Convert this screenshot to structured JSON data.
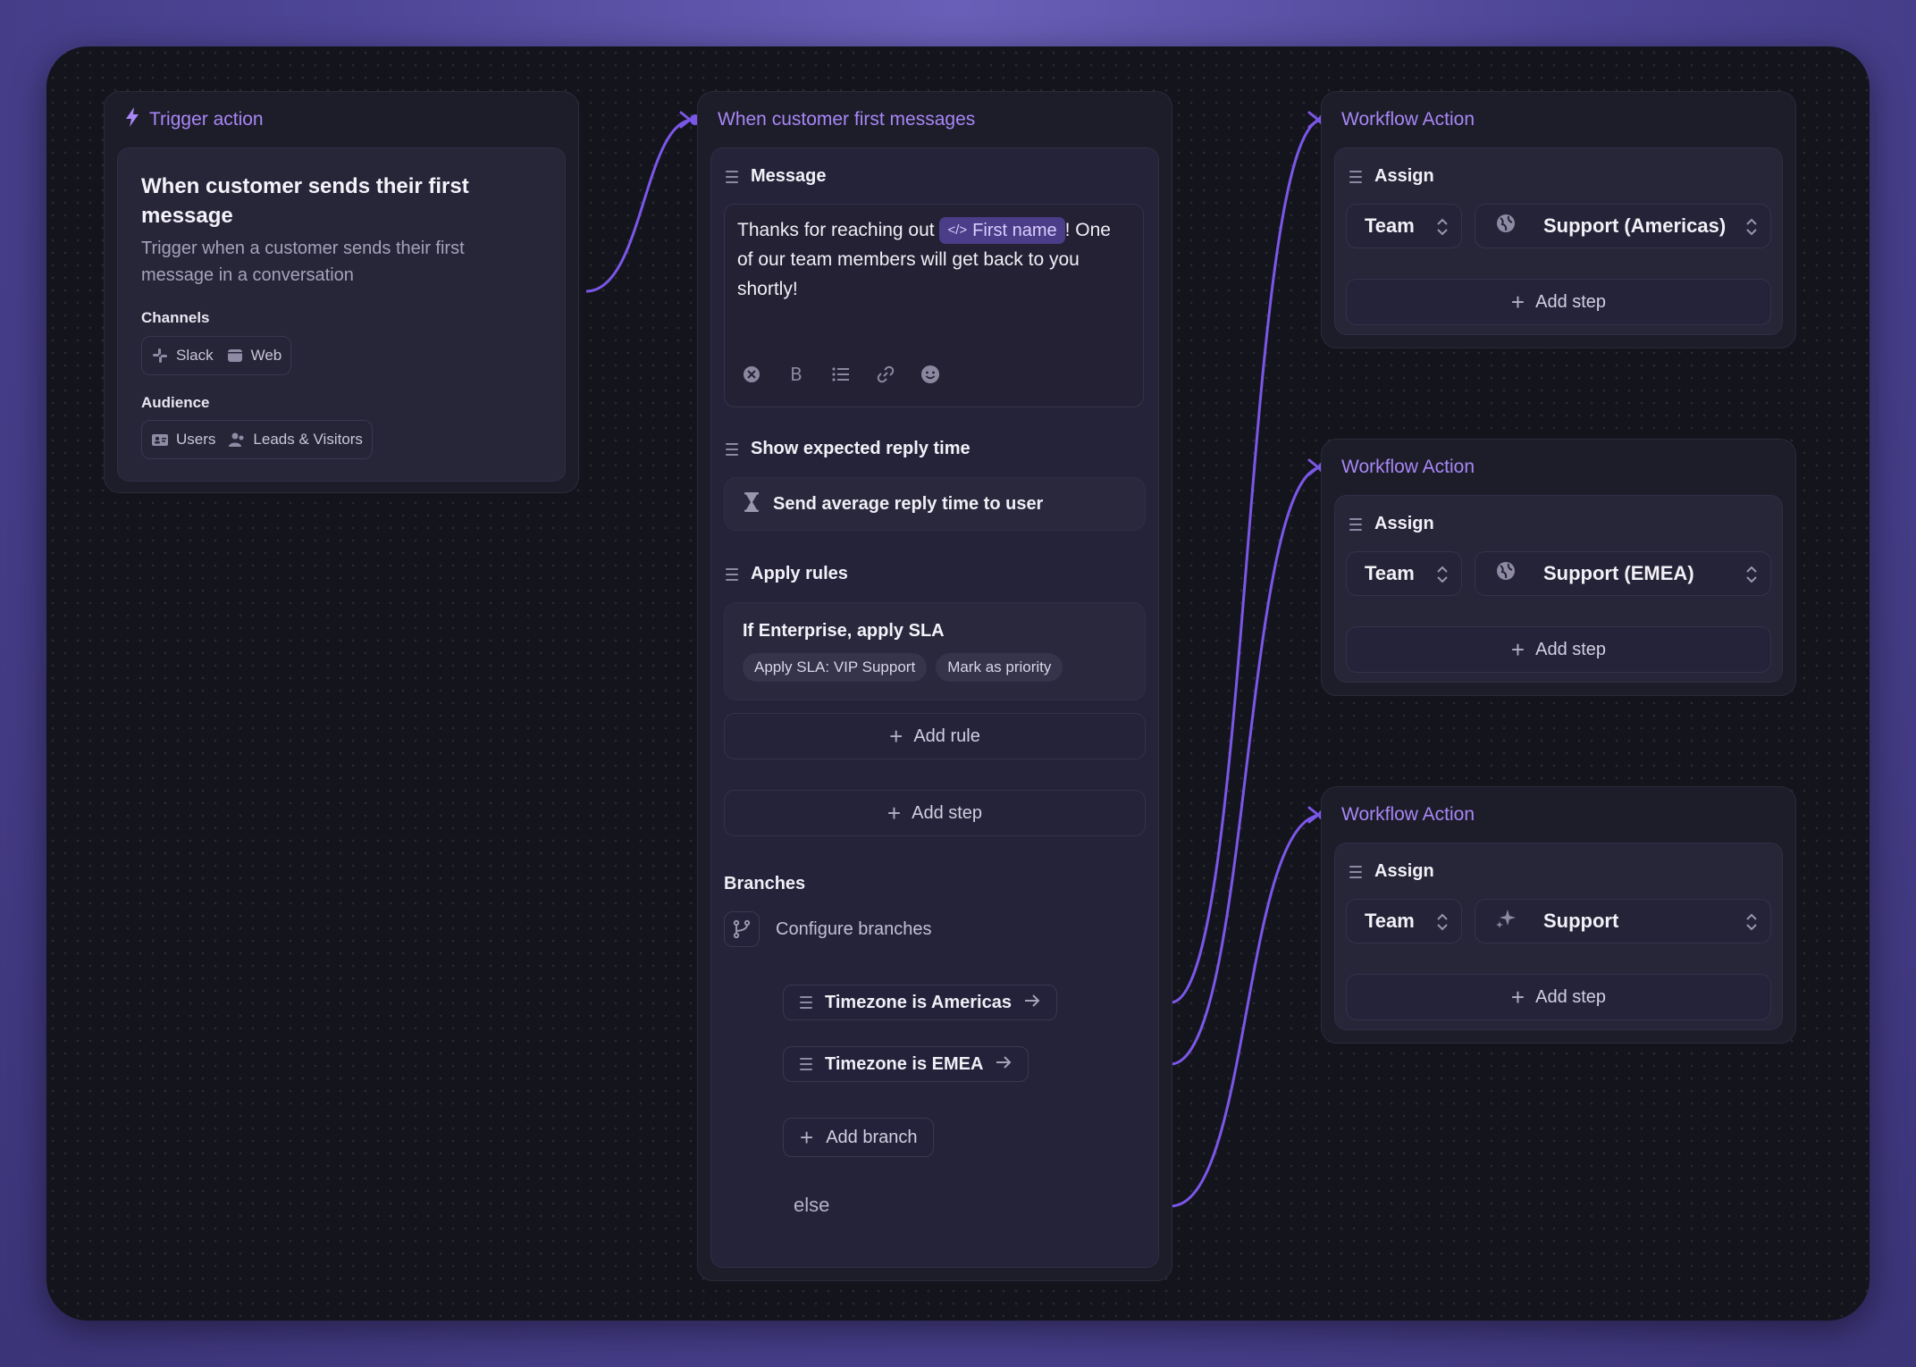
{
  "colors": {
    "accent": "#a787f5",
    "wire": "#7b57e8",
    "canvas": "#14141c",
    "node": "#1d1c29",
    "card": "#272538"
  },
  "trigger": {
    "header": "Trigger action",
    "header_icon": "lightning-icon",
    "title": "When customer sends their first message",
    "description": "Trigger when a customer sends their first message in a conversation",
    "channels_label": "Channels",
    "channels": [
      {
        "icon": "slack-icon",
        "label": "Slack"
      },
      {
        "icon": "web-icon",
        "label": "Web"
      }
    ],
    "audience_label": "Audience",
    "audience": [
      {
        "icon": "users-icon",
        "label": "Users"
      },
      {
        "icon": "leads-icon",
        "label": "Leads & Visitors"
      }
    ]
  },
  "flow": {
    "header": "When customer first messages",
    "message_title": "Message",
    "message_text_before": "Thanks for reaching out",
    "message_variable": "First name",
    "message_text_after": "! One of our team members will get back to you shortly!",
    "reply_time_title": "Show expected reply time",
    "reply_time_action": "Send average reply time to user",
    "rules_title": "Apply rules",
    "rule_name": "If Enterprise, apply SLA",
    "rule_tags": [
      "Apply SLA: VIP Support",
      "Mark as priority"
    ],
    "add_rule_label": "Add rule",
    "add_step_label": "Add step",
    "branches_title": "Branches",
    "configure_branches_label": "Configure branches",
    "branches": [
      "Timezone is Americas",
      "Timezone is EMEA"
    ],
    "add_branch_label": "Add branch",
    "else_label": "else"
  },
  "actions": [
    {
      "header": "Workflow Action",
      "title": "Assign",
      "type_value": "Team",
      "target_icon": "globe-icon",
      "target_value": "Support (Americas)",
      "add_step_label": "Add step"
    },
    {
      "header": "Workflow Action",
      "title": "Assign",
      "type_value": "Team",
      "target_icon": "globe-icon",
      "target_value": "Support (EMEA)",
      "add_step_label": "Add step"
    },
    {
      "header": "Workflow Action",
      "title": "Assign",
      "type_value": "Team",
      "target_icon": "sparkle-icon",
      "target_value": "Support",
      "add_step_label": "Add step"
    }
  ]
}
